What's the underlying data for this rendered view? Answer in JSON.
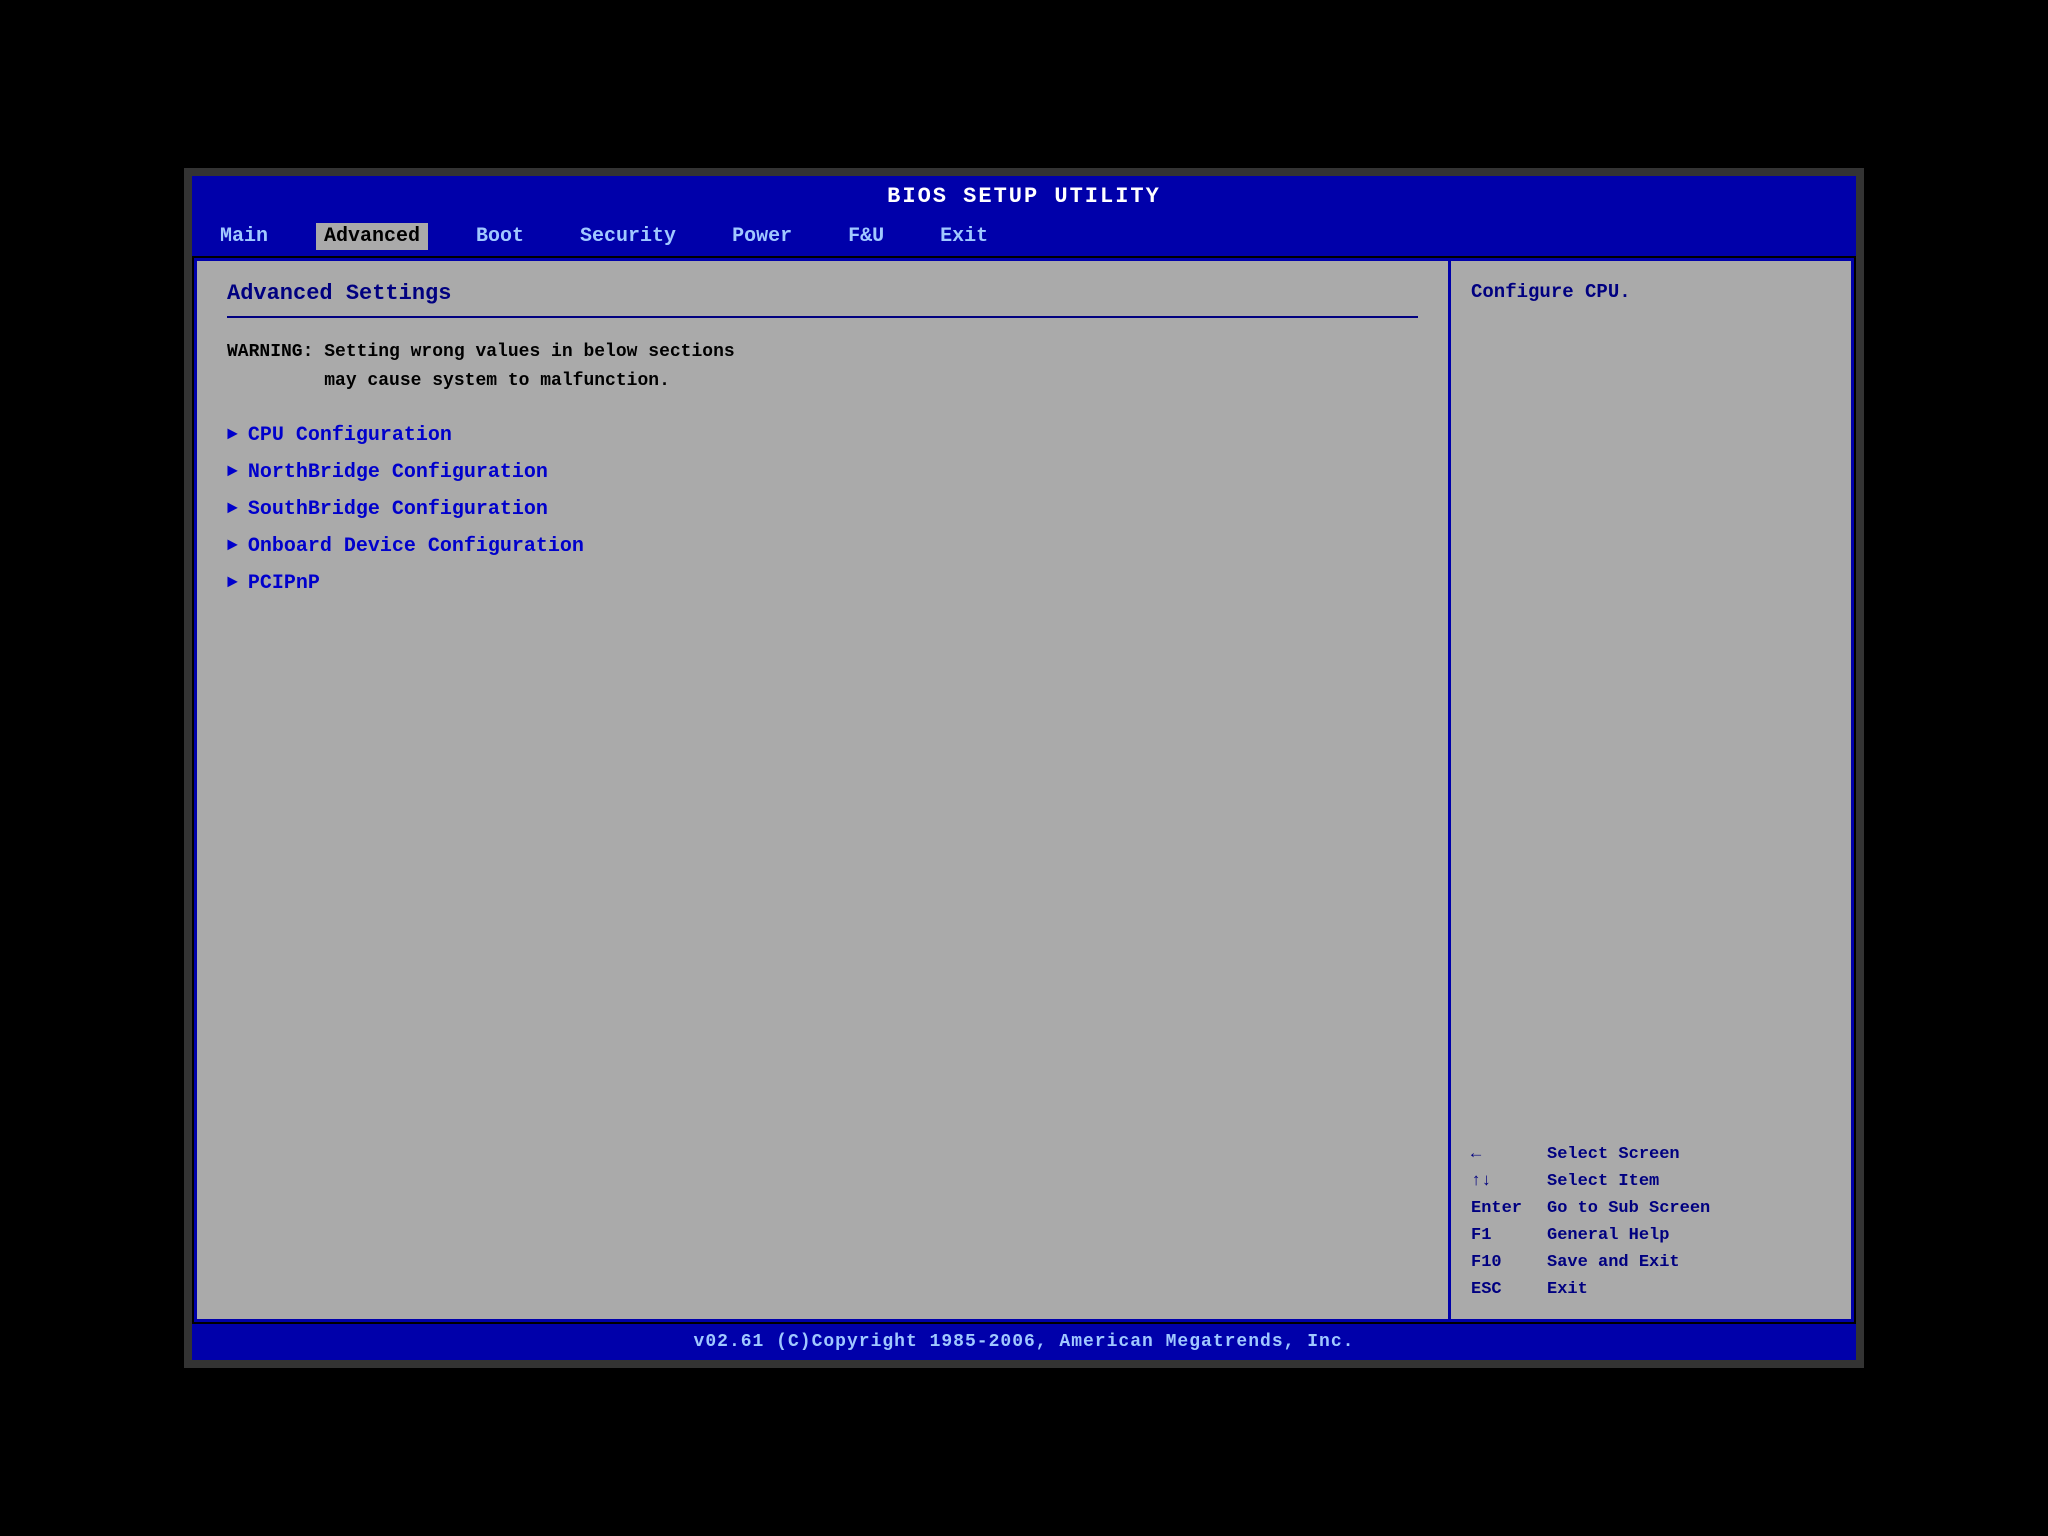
{
  "title_bar": {
    "text": "BIOS SETUP UTILITY"
  },
  "menu_bar": {
    "items": [
      {
        "label": "Main",
        "active": false
      },
      {
        "label": "Advanced",
        "active": true
      },
      {
        "label": "Boot",
        "active": false
      },
      {
        "label": "Security",
        "active": false
      },
      {
        "label": "Power",
        "active": false
      },
      {
        "label": "F&U",
        "active": false
      },
      {
        "label": "Exit",
        "active": false
      }
    ]
  },
  "main_panel": {
    "title": "Advanced Settings",
    "warning": "WARNING: Setting wrong values in below sections\n         may cause system to malfunction.",
    "menu_items": [
      {
        "label": "CPU Configuration"
      },
      {
        "label": "NorthBridge Configuration"
      },
      {
        "label": "SouthBridge Configuration"
      },
      {
        "label": "Onboard Device Configuration"
      },
      {
        "label": "PCIPnP"
      }
    ]
  },
  "side_panel": {
    "help_text": "Configure CPU.",
    "key_legend": [
      {
        "key": "←",
        "desc": "Select Screen"
      },
      {
        "key": "↑↓",
        "desc": "Select Item"
      },
      {
        "key": "Enter",
        "desc": "Go to Sub Screen"
      },
      {
        "key": "F1",
        "desc": "General Help"
      },
      {
        "key": "F10",
        "desc": "Save and Exit"
      },
      {
        "key": "ESC",
        "desc": "Exit"
      }
    ]
  },
  "footer": {
    "text": "v02.61 (C)Copyright 1985-2006, American Megatrends, Inc."
  }
}
